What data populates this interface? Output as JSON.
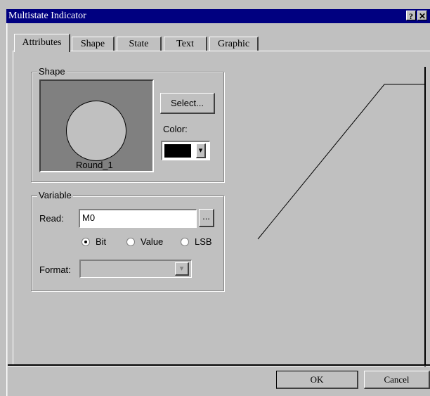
{
  "window": {
    "title": "Multistate Indicator",
    "help_label": "?",
    "close_label": "✕"
  },
  "tabs": [
    {
      "label": "Attributes"
    },
    {
      "label": "Shape"
    },
    {
      "label": "State"
    },
    {
      "label": "Text"
    },
    {
      "label": "Graphic"
    }
  ],
  "shape_group": {
    "label": "Shape",
    "preview_name": "Round_1",
    "select_label": "Select...",
    "color_label": "Color:",
    "color_value": "#000000",
    "dropdown_arrow": "▾"
  },
  "variable_group": {
    "label": "Variable",
    "read_label": "Read:",
    "read_value": "M0",
    "browse_label": "...",
    "options": [
      {
        "label": "Bit",
        "selected": true
      },
      {
        "label": "Value",
        "selected": false
      },
      {
        "label": "LSB",
        "selected": false
      }
    ],
    "format_label": "Format:",
    "format_value": ""
  },
  "footer": {
    "ok_label": "OK",
    "cancel_label": "Cancel"
  }
}
